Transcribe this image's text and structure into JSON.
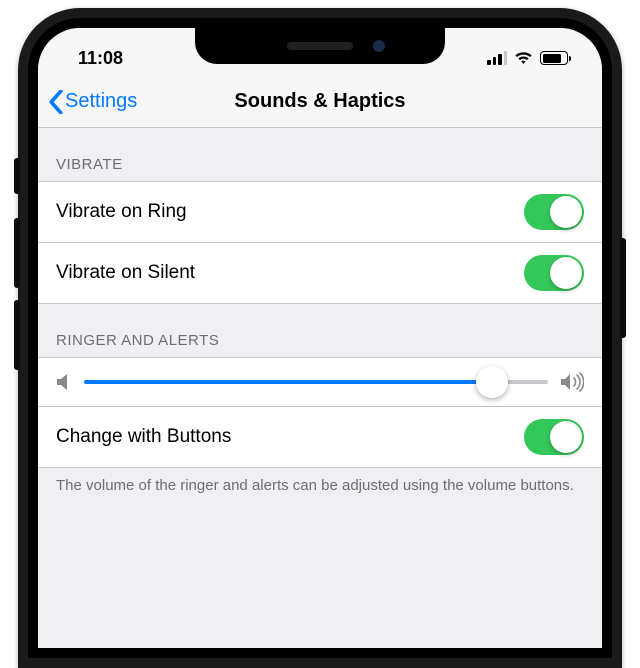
{
  "status_bar": {
    "time": "11:08",
    "battery_pct": 80,
    "signal_bars": 3
  },
  "nav": {
    "back_label": "Settings",
    "title": "Sounds & Haptics"
  },
  "sections": {
    "vibrate": {
      "header": "VIBRATE",
      "rows": [
        {
          "label": "Vibrate on Ring",
          "on": true
        },
        {
          "label": "Vibrate on Silent",
          "on": true
        }
      ]
    },
    "ringer": {
      "header": "RINGER AND ALERTS",
      "slider_value": 0.88,
      "change_buttons": {
        "label": "Change with Buttons",
        "on": true
      },
      "footer": "The volume of the ringer and alerts can be adjusted using the volume buttons."
    }
  },
  "colors": {
    "tint": "#007aff",
    "switch_on": "#34c759",
    "table_bg": "#efeff4",
    "separator": "#c8c7cc",
    "secondary_text": "#6d6d72"
  }
}
